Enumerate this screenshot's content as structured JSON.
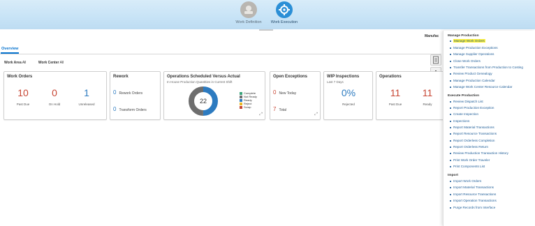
{
  "banner": {
    "items": [
      {
        "label": "Work Definition",
        "icon": "work-definition-icon",
        "active": false
      },
      {
        "label": "Work Execution",
        "icon": "work-execution-icon",
        "active": true
      }
    ]
  },
  "header": {
    "org_label": "Manufac",
    "tab": "Overview"
  },
  "filters": {
    "work_area_label": "Work Area",
    "work_area_value": "All",
    "work_center_label": "Work Center",
    "work_center_value": "All"
  },
  "cards": {
    "work_orders": {
      "title": "Work Orders",
      "metrics": [
        {
          "value": "10",
          "label": "Past Due",
          "color": "#c74634"
        },
        {
          "value": "0",
          "label": "On Hold",
          "color": "#c74634"
        },
        {
          "value": "1",
          "label": "Unreleased",
          "color": "#2d7bc0"
        }
      ]
    },
    "rework": {
      "title": "Rework",
      "rows": [
        {
          "value": "0",
          "label": "Rework Orders"
        },
        {
          "value": "0",
          "label": "Transform Orders"
        }
      ]
    },
    "ops_scheduled": {
      "title": "Operations Scheduled Versus Actual",
      "subtitle": "In House Production Quantities in Current Shift",
      "center_value": "22",
      "legend": [
        {
          "label": "Complete",
          "color": "#3aa37b"
        },
        {
          "label": "Not Ready",
          "color": "#6e6e6e"
        },
        {
          "label": "Ready",
          "color": "#2d7bc0"
        },
        {
          "label": "Reject",
          "color": "#e9b824"
        },
        {
          "label": "Scrap",
          "color": "#c74634"
        }
      ],
      "donut": [
        {
          "label": "Ready",
          "fraction": 0.5,
          "color": "#2d7bc0"
        },
        {
          "label": "Not Ready",
          "fraction": 0.5,
          "color": "#6e6e6e"
        }
      ]
    },
    "open_exceptions": {
      "title": "Open Exceptions",
      "rows": [
        {
          "value": "0",
          "label": "New Today"
        },
        {
          "value": "7",
          "label": "Total"
        }
      ]
    },
    "wip": {
      "title": "WIP Inspections",
      "subtitle": "Last 7 Days",
      "value": "0%",
      "label": "Rejected"
    },
    "operations": {
      "title": "Operations",
      "metrics": [
        {
          "value": "11",
          "label": "Past Due",
          "color": "#c74634"
        },
        {
          "value": "11",
          "label": "Ready",
          "color": "#c74634"
        }
      ]
    }
  },
  "panel": {
    "sections": [
      {
        "heading": "Manage Production",
        "links": [
          "Manage Work Orders",
          "Manage Production Exceptions",
          "Manage Supplier Operations",
          "Close Work Orders",
          "Transfer Transactions from Production to Costing",
          "Review Product Genealogy",
          "Manage Production Calendar",
          "Manage Work Center Resource Calendar"
        ]
      },
      {
        "heading": "Execute Production",
        "links": [
          "Review Dispatch List",
          "Report Production Exception",
          "Create Inspection",
          "Inspections",
          "Report Material Transactions",
          "Report Resource Transactions",
          "Report Orderless Completion",
          "Report Orderless Return",
          "Review Production Transaction History",
          "Print Work Order Traveler",
          "Print Components List"
        ]
      },
      {
        "heading": "Import",
        "links": [
          "Import Work Orders",
          "Import Material Transactions",
          "Import Resource Transactions",
          "Import Operation Transactions",
          "Purge Records from Interface"
        ]
      }
    ],
    "highlighted_link": "Manage Work Orders"
  }
}
